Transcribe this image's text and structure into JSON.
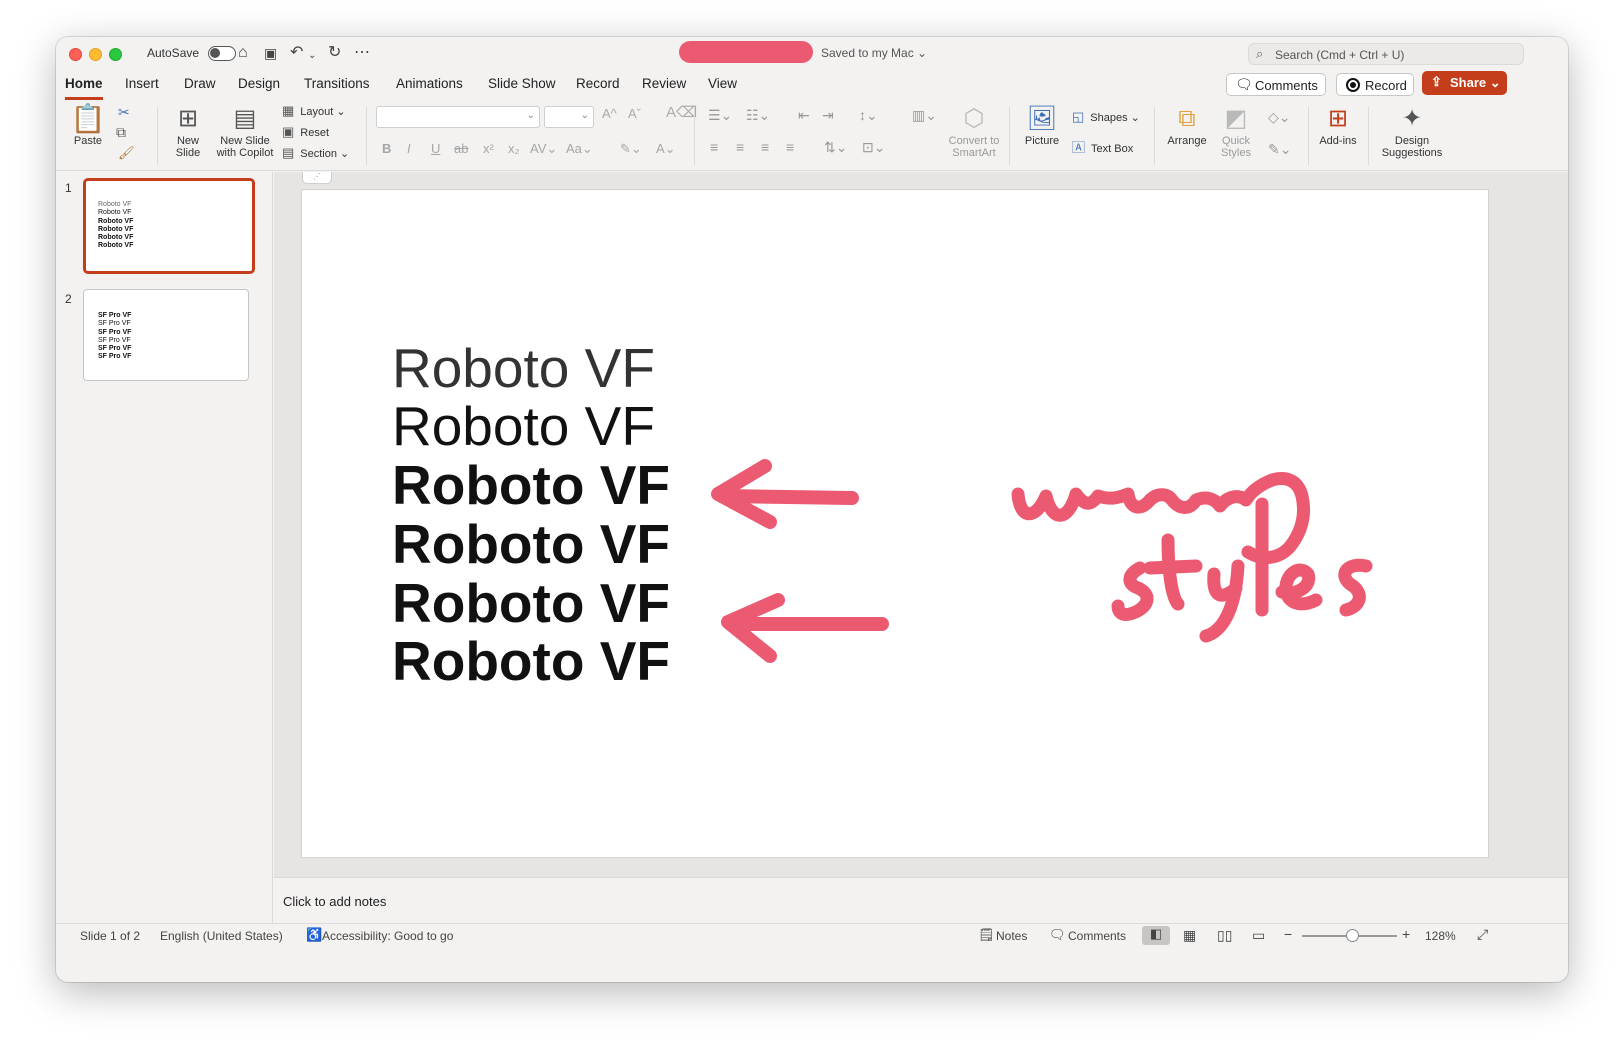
{
  "titlebar": {
    "autosave_label": "AutoSave",
    "save_status": "Saved to my Mac ⌄",
    "search_placeholder": "Search (Cmd + Ctrl + U)"
  },
  "tabs": [
    "Home",
    "Insert",
    "Draw",
    "Design",
    "Transitions",
    "Animations",
    "Slide Show",
    "Record",
    "Review",
    "View"
  ],
  "actions": {
    "comments": "Comments",
    "record": "Record",
    "share": "Share ⌄"
  },
  "ribbon": {
    "paste": "Paste",
    "new_slide": [
      "New",
      "Slide"
    ],
    "new_slide_copilot": [
      "New Slide",
      "with Copilot"
    ],
    "layout": "Layout ⌄",
    "reset": "Reset",
    "section": "Section ⌄",
    "convert_smartart": [
      "Convert to",
      "SmartArt"
    ],
    "picture": "Picture",
    "shapes": "Shapes ⌄",
    "text_box": "Text Box",
    "arrange": "Arrange",
    "quick_styles": [
      "Quick",
      "Styles"
    ],
    "add_ins": "Add-ins",
    "design_suggestions": [
      "Design",
      "Suggestions"
    ]
  },
  "slides": [
    {
      "number": "1",
      "lines": [
        "Roboto VF",
        "Roboto VF",
        "Roboto VF",
        "Roboto VF",
        "Roboto VF",
        "Roboto VF"
      ]
    },
    {
      "number": "2",
      "lines": [
        "SF Pro VF",
        "SF Pro VF",
        "SF Pro VF",
        "SF Pro VF",
        "SF Pro VF",
        "SF Pro VF"
      ]
    }
  ],
  "slide_content": {
    "lines": [
      "Roboto VF",
      "Roboto VF",
      "Roboto VF",
      "Roboto VF",
      "Roboto VF",
      "Roboto VF"
    ],
    "annotation": "wrong styles",
    "annotation_color": "#ec5a72"
  },
  "notes_placeholder": "Click to add notes",
  "status": {
    "slide_info": "Slide 1 of 2",
    "language": "English (United States)",
    "accessibility": "Accessibility: Good to go",
    "notes": "Notes",
    "comments": "Comments",
    "zoom": "128%"
  },
  "colors": {
    "accent": "#c43e1c",
    "ink": "#ec5a72"
  }
}
